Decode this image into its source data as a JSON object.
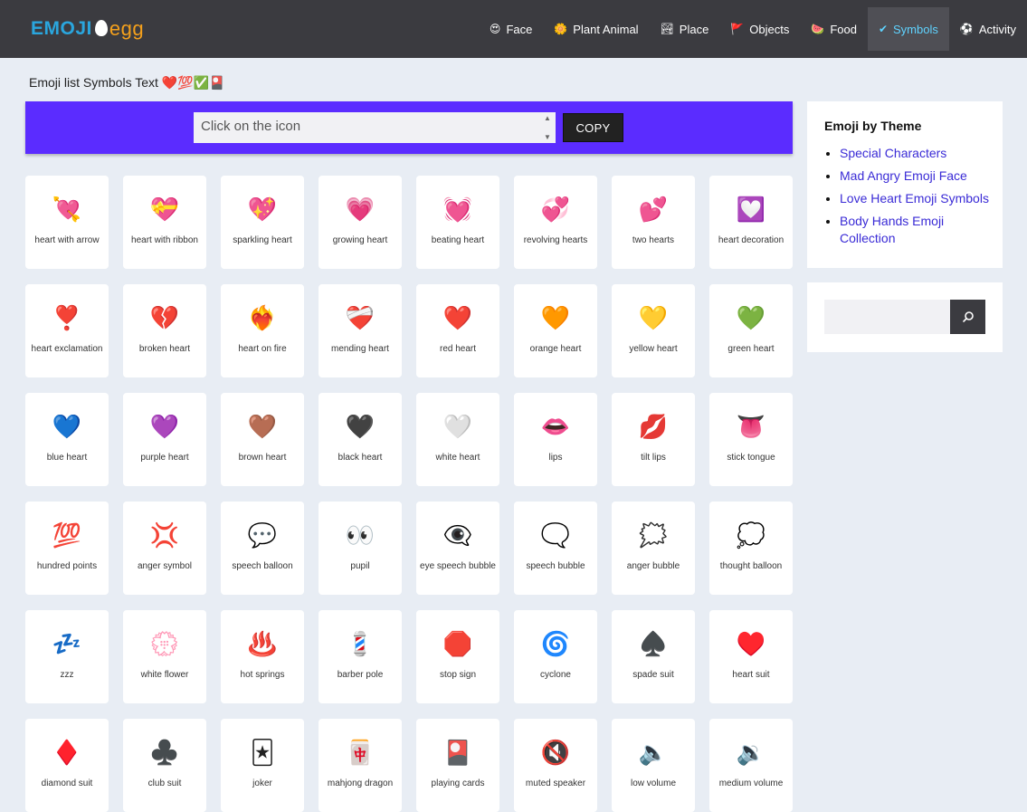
{
  "logo": {
    "part1": "EMOJI",
    "part2": "egg"
  },
  "nav": [
    {
      "icon": "😍",
      "label": "Face",
      "active": false
    },
    {
      "icon": "🌼",
      "label": "Plant Animal",
      "active": false
    },
    {
      "icon": "🏞",
      "label": "Place",
      "active": false
    },
    {
      "icon": "🚩",
      "label": "Objects",
      "active": false
    },
    {
      "icon": "🍉",
      "label": "Food",
      "active": false
    },
    {
      "icon": "✔",
      "label": "Symbols",
      "active": true
    },
    {
      "icon": "⚽",
      "label": "Activity",
      "active": false
    }
  ],
  "page_title": "Emoji list Symbols Text ❤️💯✅🎴",
  "copy_bar": {
    "placeholder": "Click on the icon",
    "button_label": "COPY"
  },
  "emojis": [
    {
      "icon": "💘",
      "name": "heart with arrow"
    },
    {
      "icon": "💝",
      "name": "heart with ribbon"
    },
    {
      "icon": "💖",
      "name": "sparkling heart"
    },
    {
      "icon": "💗",
      "name": "growing heart"
    },
    {
      "icon": "💓",
      "name": "beating heart"
    },
    {
      "icon": "💞",
      "name": "revolving hearts"
    },
    {
      "icon": "💕",
      "name": "two hearts"
    },
    {
      "icon": "💟",
      "name": "heart decoration"
    },
    {
      "icon": "❣️",
      "name": "heart exclamation"
    },
    {
      "icon": "💔",
      "name": "broken heart"
    },
    {
      "icon": "❤️‍🔥",
      "name": "heart on fire"
    },
    {
      "icon": "❤️‍🩹",
      "name": "mending heart"
    },
    {
      "icon": "❤️",
      "name": "red heart"
    },
    {
      "icon": "🧡",
      "name": "orange heart"
    },
    {
      "icon": "💛",
      "name": "yellow heart"
    },
    {
      "icon": "💚",
      "name": "green heart"
    },
    {
      "icon": "💙",
      "name": "blue heart"
    },
    {
      "icon": "💜",
      "name": "purple heart"
    },
    {
      "icon": "🤎",
      "name": "brown heart"
    },
    {
      "icon": "🖤",
      "name": "black heart"
    },
    {
      "icon": "🤍",
      "name": "white heart"
    },
    {
      "icon": "👄",
      "name": "lips"
    },
    {
      "icon": "💋",
      "name": "tilt lips"
    },
    {
      "icon": "👅",
      "name": "stick tongue"
    },
    {
      "icon": "💯",
      "name": "hundred points"
    },
    {
      "icon": "💢",
      "name": "anger symbol"
    },
    {
      "icon": "💬",
      "name": "speech balloon"
    },
    {
      "icon": "👀",
      "name": "pupil"
    },
    {
      "icon": "👁️‍🗨️",
      "name": "eye speech bubble"
    },
    {
      "icon": "🗨️",
      "name": "speech bubble"
    },
    {
      "icon": "🗯️",
      "name": "anger bubble"
    },
    {
      "icon": "💭",
      "name": "thought balloon"
    },
    {
      "icon": "💤",
      "name": "zzz"
    },
    {
      "icon": "💮",
      "name": "white flower"
    },
    {
      "icon": "♨️",
      "name": "hot springs"
    },
    {
      "icon": "💈",
      "name": "barber pole"
    },
    {
      "icon": "🛑",
      "name": "stop sign"
    },
    {
      "icon": "🌀",
      "name": "cyclone"
    },
    {
      "icon": "♠️",
      "name": "spade suit"
    },
    {
      "icon": "♥️",
      "name": "heart suit"
    },
    {
      "icon": "♦️",
      "name": "diamond suit"
    },
    {
      "icon": "♣️",
      "name": "club suit"
    },
    {
      "icon": "🃏",
      "name": "joker"
    },
    {
      "icon": "🀄",
      "name": "mahjong dragon"
    },
    {
      "icon": "🎴",
      "name": "playing cards"
    },
    {
      "icon": "🔇",
      "name": "muted speaker"
    },
    {
      "icon": "🔈",
      "name": "low volume"
    },
    {
      "icon": "🔉",
      "name": "medium volume"
    }
  ],
  "sidebar": {
    "theme_title": "Emoji by Theme",
    "theme_links": [
      "Special Characters",
      "Mad Angry Emoji Face",
      "Love Heart Emoji Symbols",
      "Body Hands Emoji Collection"
    ],
    "search_icon": "search-icon"
  }
}
